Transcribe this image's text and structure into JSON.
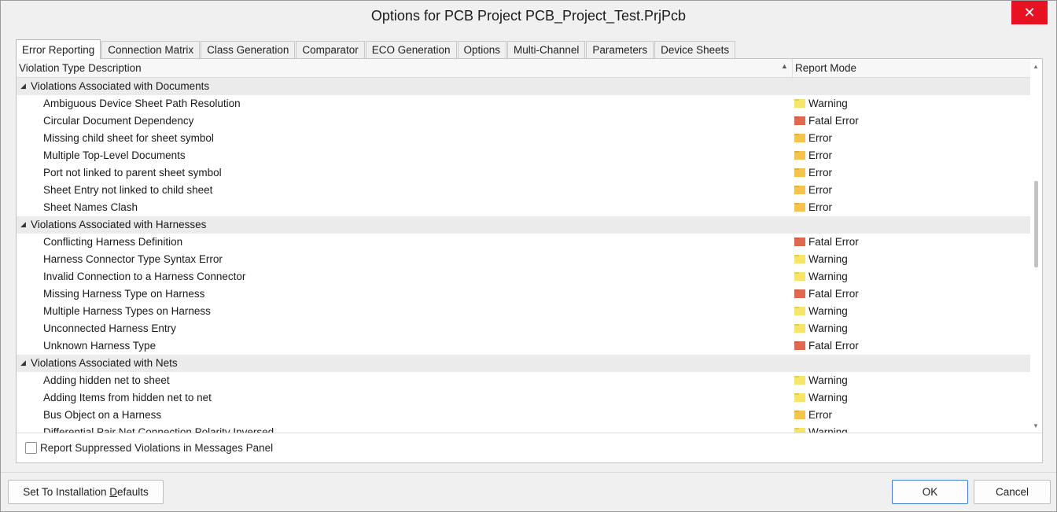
{
  "window": {
    "title": "Options for PCB Project PCB_Project_Test.PrjPcb",
    "close_glyph": "✕"
  },
  "tabs": [
    {
      "label": "Error Reporting",
      "active": true
    },
    {
      "label": "Connection Matrix",
      "active": false
    },
    {
      "label": "Class Generation",
      "active": false
    },
    {
      "label": "Comparator",
      "active": false
    },
    {
      "label": "ECO Generation",
      "active": false
    },
    {
      "label": "Options",
      "active": false
    },
    {
      "label": "Multi-Channel",
      "active": false
    },
    {
      "label": "Parameters",
      "active": false
    },
    {
      "label": "Device Sheets",
      "active": false
    }
  ],
  "grid": {
    "columns": {
      "description": "Violation Type Description",
      "mode": "Report Mode",
      "sort_glyph": "▲"
    },
    "groups": [
      {
        "label": "Violations Associated with Documents",
        "expander": "◢",
        "items": [
          {
            "description": "Ambiguous Device Sheet Path Resolution",
            "mode": "Warning",
            "icon": "warning"
          },
          {
            "description": "Circular Document Dependency",
            "mode": "Fatal Error",
            "icon": "fatal"
          },
          {
            "description": "Missing child sheet for sheet symbol",
            "mode": "Error",
            "icon": "error"
          },
          {
            "description": "Multiple Top-Level Documents",
            "mode": "Error",
            "icon": "error"
          },
          {
            "description": "Port not linked to parent sheet symbol",
            "mode": "Error",
            "icon": "error"
          },
          {
            "description": "Sheet Entry not linked to child sheet",
            "mode": "Error",
            "icon": "error"
          },
          {
            "description": "Sheet Names Clash",
            "mode": "Error",
            "icon": "error"
          }
        ]
      },
      {
        "label": "Violations Associated with Harnesses",
        "expander": "◢",
        "items": [
          {
            "description": "Conflicting Harness Definition",
            "mode": "Fatal Error",
            "icon": "fatal"
          },
          {
            "description": "Harness Connector Type Syntax Error",
            "mode": "Warning",
            "icon": "warning"
          },
          {
            "description": "Invalid Connection to a Harness Connector",
            "mode": "Warning",
            "icon": "warning"
          },
          {
            "description": "Missing Harness Type on Harness",
            "mode": "Fatal Error",
            "icon": "fatal"
          },
          {
            "description": "Multiple Harness Types on Harness",
            "mode": "Warning",
            "icon": "warning"
          },
          {
            "description": "Unconnected Harness Entry",
            "mode": "Warning",
            "icon": "warning"
          },
          {
            "description": "Unknown Harness Type",
            "mode": "Fatal Error",
            "icon": "fatal"
          }
        ]
      },
      {
        "label": "Violations Associated with Nets",
        "expander": "◢",
        "items": [
          {
            "description": "Adding hidden net to sheet",
            "mode": "Warning",
            "icon": "warning"
          },
          {
            "description": "Adding Items from hidden net to net",
            "mode": "Warning",
            "icon": "warning"
          },
          {
            "description": "Bus Object on a Harness",
            "mode": "Error",
            "icon": "error"
          },
          {
            "description": "Differential Pair Net Connection Polarity Inversed",
            "mode": "Warning",
            "icon": "warning"
          }
        ]
      }
    ],
    "scroll_up_glyph": "▲",
    "scroll_down_glyph": "▼"
  },
  "options": {
    "report_suppressed_label": "Report Suppressed Violations in Messages Panel",
    "report_suppressed_checked": false
  },
  "buttons": {
    "defaults_prefix": "Set To Installation ",
    "defaults_accel": "D",
    "defaults_suffix": "efaults",
    "ok": "OK",
    "cancel": "Cancel"
  },
  "colors": {
    "warning_folder": "#f7e56a",
    "error_folder": "#f6c34d",
    "fatal_folder": "#e0684f",
    "close_button": "#e81123",
    "ok_border": "#3c7fd1"
  }
}
